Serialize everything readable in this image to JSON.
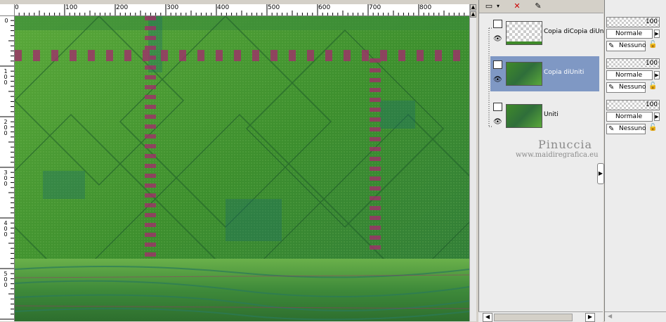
{
  "ruler": {
    "top_ticks": [
      "0",
      "100",
      "200",
      "300",
      "400",
      "500",
      "600",
      "700",
      "800"
    ],
    "left_ticks": [
      "0",
      "100",
      "200",
      "300",
      "400",
      "500"
    ]
  },
  "layers_toolbar": {
    "icons": [
      "new-layer-icon",
      "dropdown-arrow-icon",
      "delete-layer-icon",
      "paint-icon"
    ]
  },
  "layers": [
    {
      "name": "Copia diCopia diUniti",
      "selected": false,
      "thumb": "transparent"
    },
    {
      "name": "Copia diUniti",
      "selected": true,
      "thumb": "green"
    },
    {
      "name": "Uniti",
      "selected": false,
      "thumb": "green"
    }
  ],
  "layer_props": [
    {
      "opacity": "100",
      "blend": "Normale",
      "mask": "Nessuno"
    },
    {
      "opacity": "100",
      "blend": "Normale",
      "mask": "Nessuno"
    },
    {
      "opacity": "100",
      "blend": "Normale",
      "mask": "Nessuno"
    }
  ],
  "watermark": {
    "title": "Pinuccia",
    "url": "www.maidiregrafica.eu"
  },
  "colors": {
    "selection": "#7f98c4",
    "panel_bg": "#ececec",
    "artwork_green": "#3f8a2a",
    "accent_magenta": "#a0306a"
  }
}
